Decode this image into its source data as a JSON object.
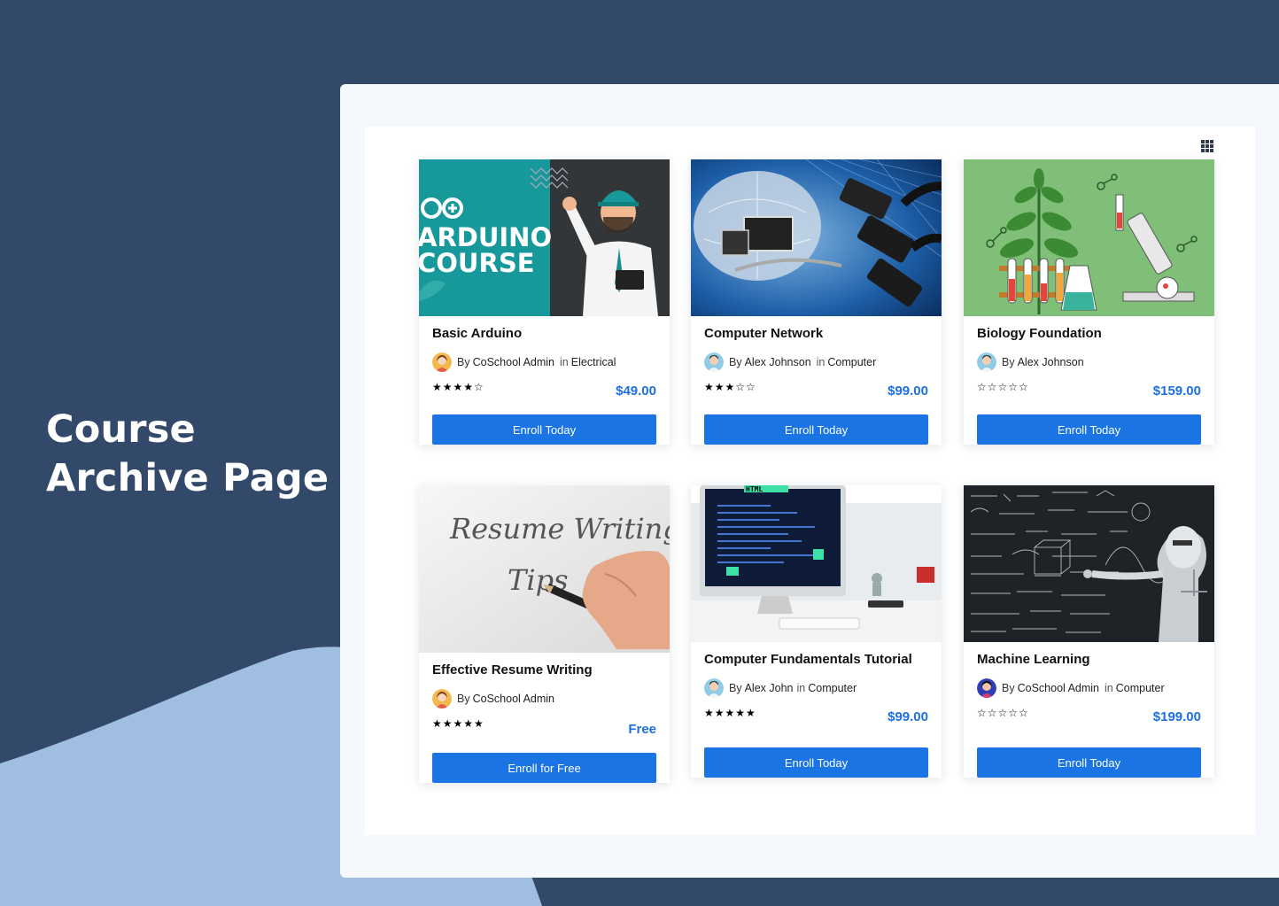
{
  "hero": {
    "line1": "Course",
    "line2": "Archive Page"
  },
  "colors": {
    "background": "#33496a",
    "accent_blob": "#a0bde2",
    "button": "#1b74e4",
    "price": "#1e6fe0",
    "star": "#f7a541"
  },
  "view_toggle": {
    "icon": "grid-view-icon"
  },
  "thumbnails": {
    "arduino": {
      "line1": "ARDUINO",
      "line2": "COURSE"
    },
    "resume": {
      "line1": "Resume Writing",
      "line2": "Tips"
    },
    "html": {
      "label": "HTML"
    }
  },
  "courses": [
    {
      "title": "Basic Arduino",
      "by": "By",
      "author": "CoSchool Admin",
      "in": "in",
      "category": "Electrical",
      "rating": 4,
      "stars": "★★★★☆",
      "price": "$49.00",
      "button": "Enroll Today"
    },
    {
      "title": "Computer Network",
      "by": "By",
      "author": "Alex Johnson",
      "in": "in",
      "category": "Computer",
      "rating": 3,
      "stars": "★★★☆☆",
      "price": "$99.00",
      "button": "Enroll Today"
    },
    {
      "title": "Biology Foundation",
      "by": "By",
      "author": "Alex Johnson",
      "in": "",
      "category": "",
      "rating": 0,
      "stars": "☆☆☆☆☆",
      "price": "$159.00",
      "button": "Enroll Today"
    },
    {
      "title": "Effective Resume Writing",
      "by": "By",
      "author": "CoSchool Admin",
      "in": "",
      "category": "",
      "rating": 5,
      "stars": "★★★★★",
      "price": "Free",
      "button": "Enroll for Free"
    },
    {
      "title": "Computer Fundamentals Tutorial",
      "by": "By",
      "author": "Alex John",
      "in": "in",
      "category": "Computer",
      "rating": 5,
      "stars": "★★★★★",
      "price": "$99.00",
      "button": "Enroll Today"
    },
    {
      "title": "Machine Learning",
      "by": "By",
      "author": "CoSchool Admin",
      "in": "in",
      "category": "Computer",
      "rating": 0,
      "stars": "☆☆☆☆☆",
      "price": "$199.00",
      "button": "Enroll Today"
    }
  ]
}
